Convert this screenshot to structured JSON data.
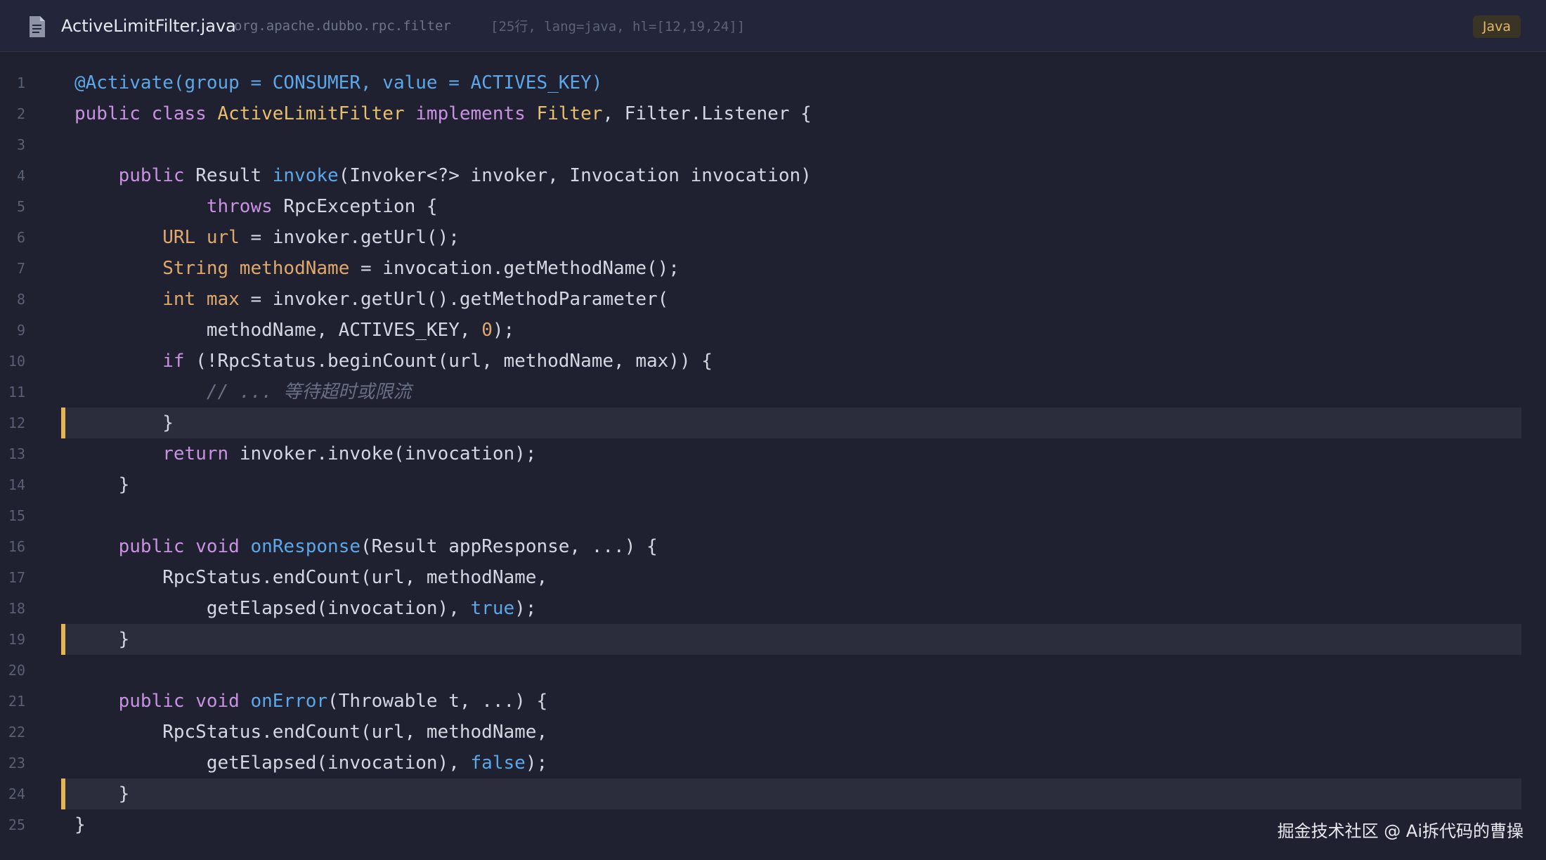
{
  "header": {
    "filename": "ActiveLimitFilter.java",
    "package": "org.apache.dubbo.rpc.filter",
    "meta": "[25行, lang=java, hl=[12,19,24]]",
    "language": "Java"
  },
  "highlighted_lines": [
    12,
    19,
    24
  ],
  "code_lines": [
    [
      [
        "ann",
        "@Activate(group = CONSUMER, value = ACTIVES_KEY)"
      ]
    ],
    [
      [
        "kw",
        "public class "
      ],
      [
        "cls",
        "ActiveLimitFilter "
      ],
      [
        "kw",
        "implements "
      ],
      [
        "cls",
        "Filter"
      ],
      [
        "p",
        ", Filter.Listener {"
      ]
    ],
    [],
    [
      [
        "p",
        "    "
      ],
      [
        "kw",
        "public "
      ],
      [
        "p",
        "Result "
      ],
      [
        "fn",
        "invoke"
      ],
      [
        "p",
        "(Invoker<?> invoker, Invocation invocation)"
      ]
    ],
    [
      [
        "p",
        "            "
      ],
      [
        "kw",
        "throws "
      ],
      [
        "p",
        "RpcException {"
      ]
    ],
    [
      [
        "p",
        "        "
      ],
      [
        "ty",
        "URL url"
      ],
      [
        "p",
        " = invoker.getUrl();"
      ]
    ],
    [
      [
        "p",
        "        "
      ],
      [
        "ty",
        "String methodName"
      ],
      [
        "p",
        " = invocation.getMethodName();"
      ]
    ],
    [
      [
        "p",
        "        "
      ],
      [
        "ty",
        "int max"
      ],
      [
        "p",
        " = invoker.getUrl().getMethodParameter("
      ]
    ],
    [
      [
        "p",
        "            methodName, ACTIVES_KEY, "
      ],
      [
        "num",
        "0"
      ],
      [
        "p",
        ");"
      ]
    ],
    [
      [
        "p",
        "        "
      ],
      [
        "kw",
        "if "
      ],
      [
        "p",
        "(!RpcStatus.beginCount(url, methodName, max)) {"
      ]
    ],
    [
      [
        "p",
        "            "
      ],
      [
        "cm",
        "// ... 等待超时或限流"
      ]
    ],
    [
      [
        "p",
        "        }"
      ]
    ],
    [
      [
        "p",
        "        "
      ],
      [
        "kw",
        "return "
      ],
      [
        "p",
        "invoker.invoke(invocation);"
      ]
    ],
    [
      [
        "p",
        "    }"
      ]
    ],
    [],
    [
      [
        "p",
        "    "
      ],
      [
        "kw",
        "public void "
      ],
      [
        "fn",
        "onResponse"
      ],
      [
        "p",
        "(Result appResponse, ...) {"
      ]
    ],
    [
      [
        "p",
        "        RpcStatus.endCount(url, methodName,"
      ]
    ],
    [
      [
        "p",
        "            getElapsed(invocation), "
      ],
      [
        "bool",
        "true"
      ],
      [
        "p",
        ");"
      ]
    ],
    [
      [
        "p",
        "    }"
      ]
    ],
    [],
    [
      [
        "p",
        "    "
      ],
      [
        "kw",
        "public void "
      ],
      [
        "fn",
        "onError"
      ],
      [
        "p",
        "(Throwable t, ...) {"
      ]
    ],
    [
      [
        "p",
        "        RpcStatus.endCount(url, methodName,"
      ]
    ],
    [
      [
        "p",
        "            getElapsed(invocation), "
      ],
      [
        "bool",
        "false"
      ],
      [
        "p",
        ");"
      ]
    ],
    [
      [
        "p",
        "    }"
      ]
    ],
    [
      [
        "p",
        "}"
      ]
    ]
  ],
  "watermark": "掘金技术社区 @ Ai拆代码的曹操"
}
